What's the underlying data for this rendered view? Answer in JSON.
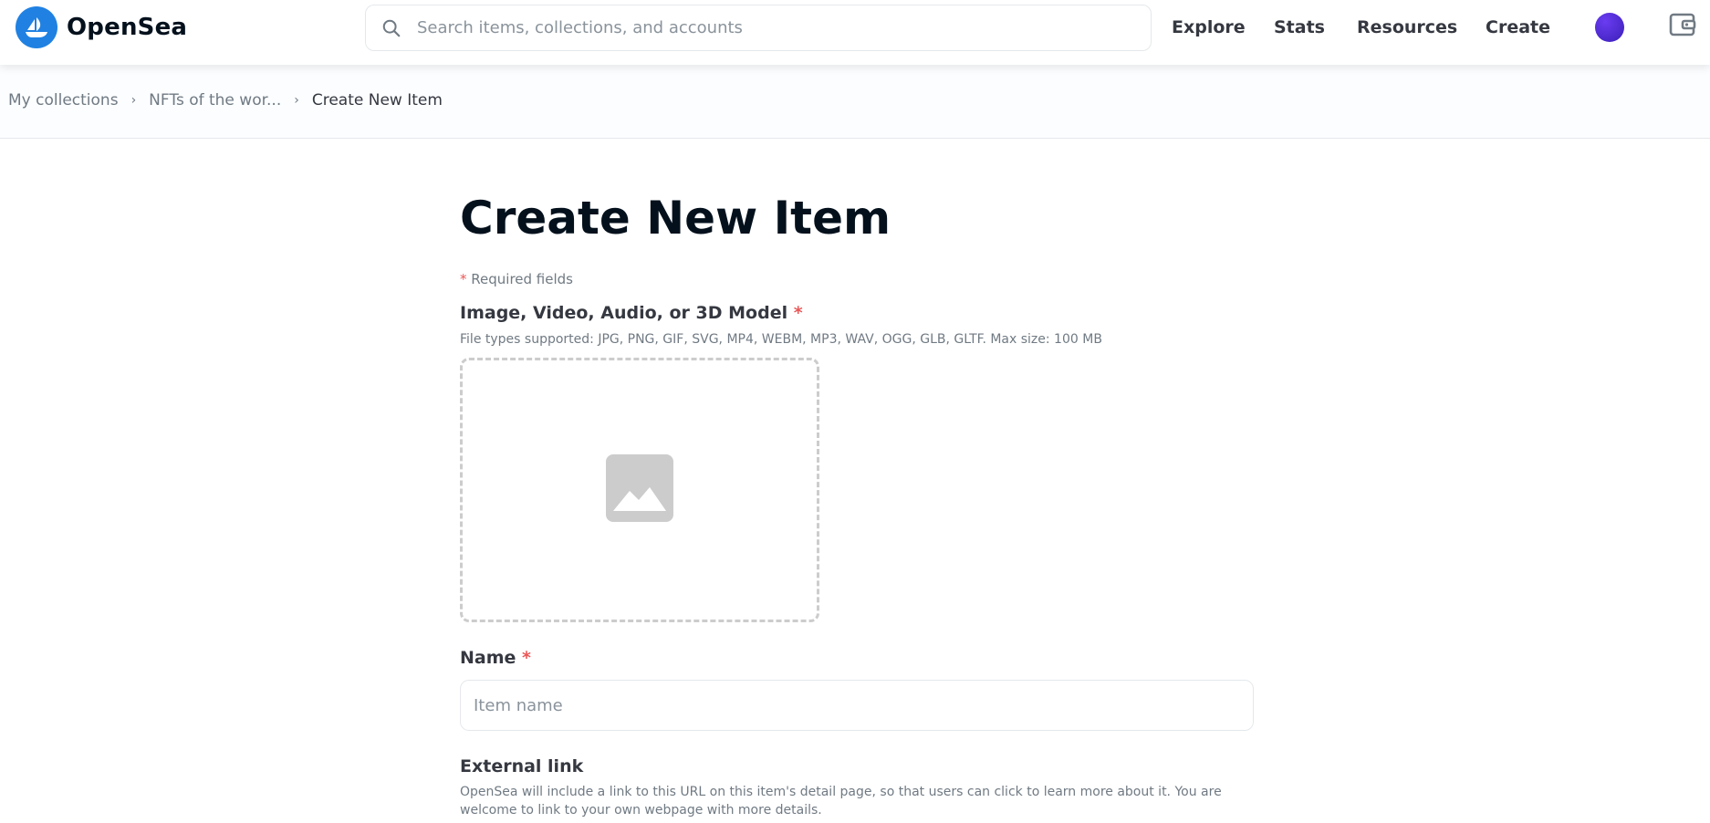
{
  "header": {
    "brand": "OpenSea",
    "search_placeholder": "Search items, collections, and accounts",
    "nav": {
      "explore": "Explore",
      "stats": "Stats",
      "resources": "Resources",
      "create": "Create"
    },
    "icons": [
      "opensea-logo-icon",
      "search-icon",
      "avatar",
      "wallet-icon"
    ]
  },
  "breadcrumb": {
    "items": [
      "My collections",
      "NFTs of the wor...",
      "Create New Item"
    ],
    "separator": "›"
  },
  "main": {
    "title": "Create New Item",
    "required_note": "Required fields",
    "required_marker": "*",
    "media": {
      "label": "Image, Video, Audio, or 3D Model",
      "hint": "File types supported: JPG, PNG, GIF, SVG, MP4, WEBM, MP3, WAV, OGG, GLB, GLTF. Max size: 100 MB"
    },
    "name": {
      "label": "Name",
      "placeholder": "Item name"
    },
    "external_link": {
      "label": "External link",
      "hint": "OpenSea will include a link to this URL on this item's detail page, so that users can click to learn more about it. You are welcome to link to your own webpage with more details."
    }
  },
  "colors": {
    "brand_blue": "#2081e2",
    "required_red": "#eb5757",
    "text_dark": "#04111d",
    "text_muted": "#707a83"
  }
}
